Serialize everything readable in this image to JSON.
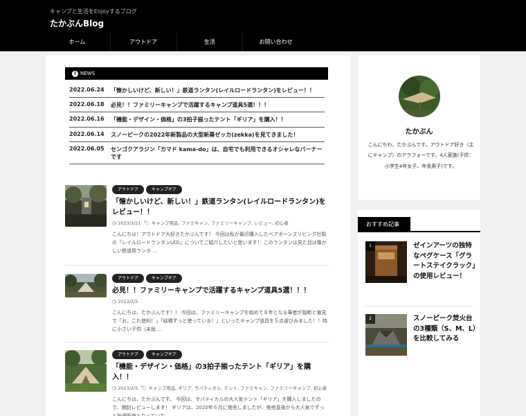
{
  "header": {
    "tagline": "キャンプと生活をEnjoyするブログ",
    "title": "たかぶんBlog"
  },
  "nav": [
    "ホーム",
    "アウトドア",
    "生活",
    "お問い合わせ"
  ],
  "news": {
    "heading": "NEWS",
    "items": [
      {
        "date": "2022.06.24",
        "text": "「懐かしいけど、新しい！」鉄道ランタン(レイルロードランタン)をレビュー！！"
      },
      {
        "date": "2022.06.18",
        "text": "必見！！ファミリーキャンプで活躍するキャンプ道具5選！！！"
      },
      {
        "date": "2022.06.16",
        "text": "「機能・デザイン・価格」の3拍子揃ったテント「ギリア」を購入！！"
      },
      {
        "date": "2022.06.14",
        "text": "スノーピークの2022年新製品の大型新幕ゼッカ(zekka)を見てきました！"
      },
      {
        "date": "2022.06.05",
        "text": "センゴクアラジン「カマド kama-do」は、自宅でも利用できるオシャレなバーナーです"
      }
    ]
  },
  "posts": [
    {
      "tags": [
        "アウトドア",
        "キャンプギア"
      ],
      "title": "「懐かしいけど、新しい！」鉄道ランタン(レイルロードランタン)をレビュー！！",
      "date": "2023/3/21",
      "categories": "キャンプ用品, ファミキャン, ファミリーキャンプ, レビュー, 初心者",
      "excerpt": "こんにちは！アウトドア大好きたかぶんです！ 今回は私が最近購入したベアボーンズリビング社製の「レイルロードランタンLED」についてご紹介したいと思います！ このランタンは見た目は懐かしい鉄道用ランタ ..."
    },
    {
      "tags": [
        "アウトドア",
        "キャンプギア"
      ],
      "title": "必見！！ファミリーキャンプで活躍するキャンプ道具5選！！！",
      "date": "2023/2/5",
      "categories": "",
      "excerpt": "こんにちは、たかぶんです！！ 今回は、ファミリーキャンプを始めて８年となる筆者が独断と偏見で「お、これ使利！」「結構ずっと使っている！」といったキャンプ道具を５点選びみました！！特に小さい子供（未就 ..."
    },
    {
      "tags": [
        "アウトドア",
        "キャンプギア"
      ],
      "title": "「機能・デザイン・価格」の3拍子揃ったテント「ギリア」を購入！！",
      "date": "2023/2/5",
      "categories": "キャンプ用品, ギリア, サバティカル, テント, ファミキャン, ファミリーキャンプ, 初心者",
      "excerpt": "こんにちは、たかぶんです。 今回は、サバティカルの大人気テント「ギリア」を購入しましたので、開封レビューします！ ギリアは、2020年６月に発売しましたが、発売直後から大人気でずっと抽選販売となっていた ..."
    }
  ],
  "profile": {
    "name": "たかぶん",
    "description": "こんにちわ、たかぶんです。アウトドア好き（主にキャンプ）のアラフォーです。4人家族(子供：小学生4年女子、年長男子)です。"
  },
  "recommended": {
    "heading": "おすすめ記事",
    "items": [
      {
        "rank": "1",
        "title": "ゼインアーツの独特なペグケース「グラートステイクラック」の使用レビュー！"
      },
      {
        "rank": "2",
        "title": "スノーピーク焚火台の3種類（S、M、L）を比較してみる"
      }
    ]
  },
  "colors": {
    "header_bg": "#000000",
    "page_bg": "#f1f1f1",
    "tag_bg": "#222222"
  }
}
